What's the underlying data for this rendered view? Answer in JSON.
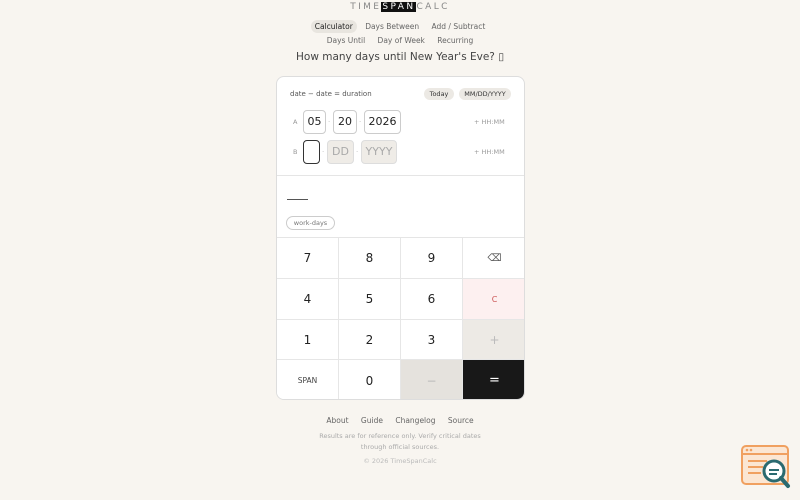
{
  "logo": {
    "part1": "TIME",
    "part2": "SPAN",
    "part3": "CALC"
  },
  "nav": {
    "row1": [
      "Calculator",
      "Days Between",
      "Add / Subtract"
    ],
    "row2": [
      "Days Until",
      "Day of Week",
      "Recurring"
    ],
    "active": "Calculator"
  },
  "question": "How many days until New Year's Eve? ▯",
  "card": {
    "formula": "date − date = duration",
    "today_label": "Today",
    "format_label": "MM/DD/YYYY",
    "row_a": {
      "label": "A",
      "month": "05",
      "day": "20",
      "year": "2026",
      "time_toggle": "+ HH:MM"
    },
    "row_b": {
      "label": "B",
      "month": "",
      "day": "DD",
      "year": "YYYY",
      "time_toggle": "+ HH:MM"
    },
    "separator": "·",
    "workdays_label": "work-days"
  },
  "keypad": {
    "k7": "7",
    "k8": "8",
    "k9": "9",
    "backspace": "⌫",
    "k4": "4",
    "k5": "5",
    "k6": "6",
    "clear": "C",
    "k1": "1",
    "k2": "2",
    "k3": "3",
    "plus": "+",
    "span": "SPAN",
    "k0": "0",
    "minus": "−",
    "equals": "="
  },
  "footer": {
    "links": [
      "About",
      "Guide",
      "Changelog",
      "Source"
    ],
    "disclaimer": "Results are for reference only. Verify critical dates through official sources.",
    "copyright": "© 2026 TimeSpanCalc"
  },
  "colors": {
    "accent_dark": "#181818",
    "clear_bg": "#fdf0f0",
    "page_bg": "#f8f5f0",
    "badge_orange": "#f0a060",
    "badge_teal": "#2a6a70"
  }
}
